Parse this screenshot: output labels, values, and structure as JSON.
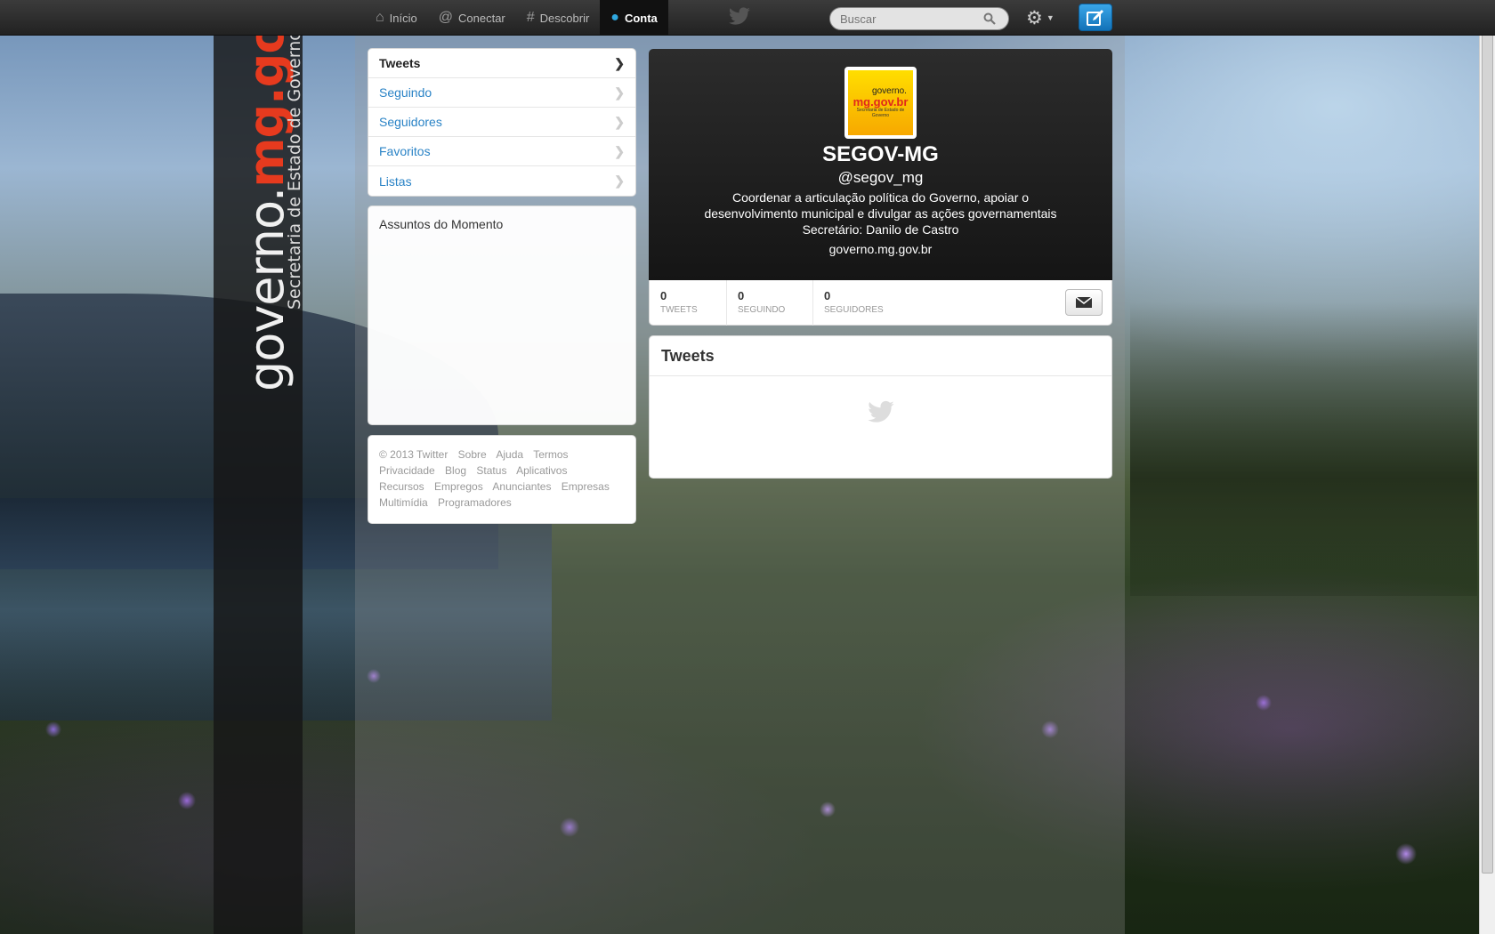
{
  "nav": {
    "items": [
      {
        "label": "Início",
        "icon": "home-icon"
      },
      {
        "label": "Conectar",
        "icon": "at-icon"
      },
      {
        "label": "Descobrir",
        "icon": "hash-icon"
      },
      {
        "label": "Conta",
        "icon": "user-icon"
      }
    ],
    "active": "Conta"
  },
  "search": {
    "placeholder": "Buscar"
  },
  "background_logo": {
    "prefix": "governo.",
    "highlight": "mg.gov.br",
    "subtitle": "Secretaria de Estado de Governo"
  },
  "sidebar": {
    "items": [
      {
        "label": "Tweets"
      },
      {
        "label": "Seguindo"
      },
      {
        "label": "Seguidores"
      },
      {
        "label": "Favoritos"
      },
      {
        "label": "Listas"
      }
    ]
  },
  "trends": {
    "title": "Assuntos do Momento"
  },
  "footer": {
    "links": [
      "© 2013 Twitter",
      "Sobre",
      "Ajuda",
      "Termos",
      "Privacidade",
      "Blog",
      "Status",
      "Aplicativos",
      "Recursos",
      "Empregos",
      "Anunciantes",
      "Empresas",
      "Multimídia",
      "Programadores"
    ]
  },
  "profile": {
    "avatar": {
      "line1": "governo.",
      "line2": "mg.gov.br",
      "line3": "Secretaria de Estado de Governo"
    },
    "name": "SEGOV-MG",
    "handle": "@segov_mg",
    "bio": "Coordenar a articulação política do Governo, apoiar o desenvolvimento municipal e divulgar as ações governamentais Secretário: Danilo de Castro",
    "url": "governo.mg.gov.br"
  },
  "stats": [
    {
      "value": "0",
      "label": "TWEETS"
    },
    {
      "value": "0",
      "label": "SEGUINDO"
    },
    {
      "value": "0",
      "label": "SEGUIDORES"
    }
  ],
  "tweets": {
    "title": "Tweets"
  },
  "colors": {
    "accent": "#2a83c6",
    "compose": "#1a86d0",
    "brand_red": "#e63a1e"
  }
}
